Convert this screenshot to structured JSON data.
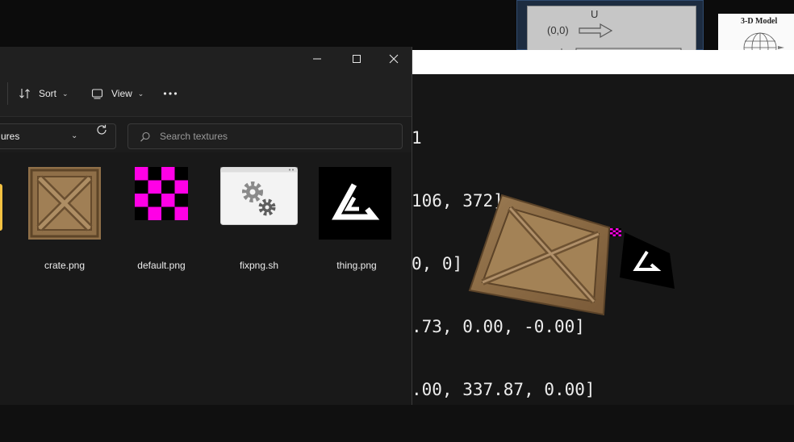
{
  "explorer": {
    "toolbar": {
      "sort_label": "Sort",
      "view_label": "View"
    },
    "address": {
      "path_text": "ures"
    },
    "search": {
      "placeholder": "Search textures"
    },
    "files": [
      {
        "name": "crate.png",
        "icon": "crate-texture"
      },
      {
        "name": "default.png",
        "icon": "checkerboard-magenta"
      },
      {
        "name": "fixpng.sh",
        "icon": "script-gears"
      },
      {
        "name": "thing.png",
        "icon": "triangle-logo"
      }
    ]
  },
  "render_window": {
    "text_lines": [
      "1",
      "106, 372]",
      "0, 0]",
      ".73, 0.00, -0.00]",
      ".00, 337.87, 0.00]"
    ]
  },
  "background": {
    "thumb_label_u": "U",
    "thumb_label_coord": "(0,0)",
    "model_card_title": "3-D Model"
  },
  "colors": {
    "explorer_bg": "#1c1c1c",
    "render_bg": "#161616",
    "checker_magenta": "#ff00e6",
    "folder_yellow": "#f5c242"
  }
}
